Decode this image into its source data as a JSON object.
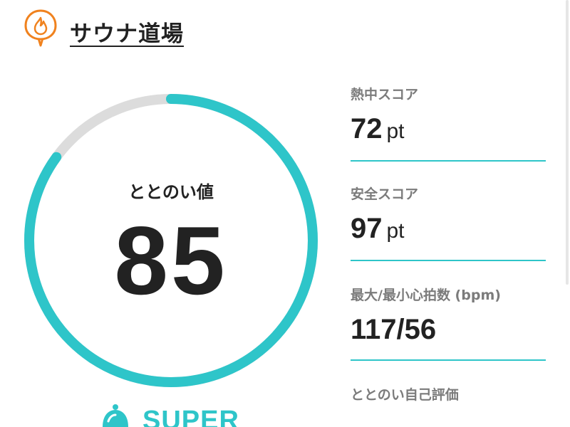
{
  "header": {
    "title": "サウナ道場",
    "logo_icon": "flame-pin-icon",
    "accent_color": "#f0821e"
  },
  "gauge": {
    "label": "ととのい値",
    "value": "85",
    "progress_fraction": 0.85,
    "fill_color": "#2ec5c9",
    "track_color": "#dcdcdc"
  },
  "rating": {
    "icon": "bell-icon",
    "text": "SUPER"
  },
  "stats": [
    {
      "label": "熱中スコア",
      "value": "72",
      "unit": "pt"
    },
    {
      "label": "安全スコア",
      "value": "97",
      "unit": "pt"
    },
    {
      "label": "最大/最小心拍数 (bpm)",
      "value": "117/56",
      "unit": ""
    },
    {
      "label": "ととのい自己評価",
      "value": "",
      "unit": ""
    }
  ]
}
